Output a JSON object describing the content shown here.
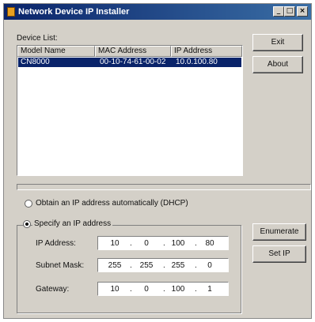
{
  "window": {
    "title": "Network Device IP Installer",
    "minimize": "_",
    "restore": "□",
    "close": "×"
  },
  "device_list": {
    "label": "Device List:",
    "columns": [
      "Model Name",
      "MAC Address",
      "IP Address"
    ],
    "rows": [
      {
        "model": "CN8000",
        "mac": "00-10-74-61-00-02",
        "ip": "10.0.100.80",
        "selected": true
      }
    ]
  },
  "buttons": {
    "exit": "Exit",
    "about": "About",
    "enumerate": "Enumerate",
    "set_ip": "Set IP"
  },
  "options": {
    "dhcp_label": "Obtain an IP address automatically (DHCP)",
    "static_label": "Specify an IP address",
    "selected": "static"
  },
  "fields": {
    "ip_label": "IP Address:",
    "ip": [
      "10",
      "0",
      "100",
      "80"
    ],
    "subnet_label": "Subnet Mask:",
    "subnet": [
      "255",
      "255",
      "255",
      "0"
    ],
    "gateway_label": "Gateway:",
    "gateway": [
      "10",
      "0",
      "100",
      "1"
    ]
  }
}
